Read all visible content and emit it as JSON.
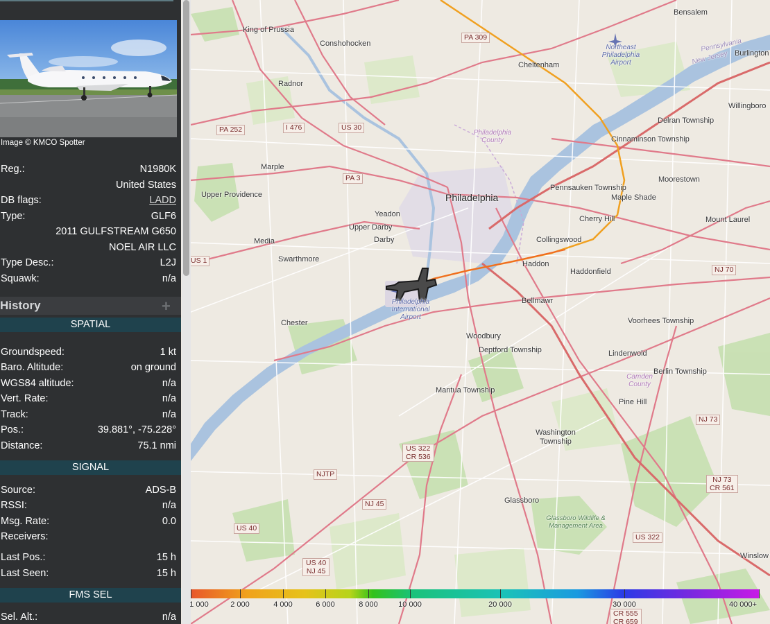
{
  "sidebar": {
    "photo_credit": "Image © KMCO Spotter",
    "details": [
      {
        "label": "Reg.:",
        "value": "N1980K"
      },
      {
        "label": "",
        "value": "United States"
      },
      {
        "label": "DB flags:",
        "value": "LADD"
      },
      {
        "label": "Type:",
        "value": "GLF6"
      },
      {
        "label": "",
        "value": "2011 GULFSTREAM G650"
      },
      {
        "label": "",
        "value": "NOEL AIR LLC"
      },
      {
        "label": "Type Desc.:",
        "value": "L2J"
      },
      {
        "label": "Squawk:",
        "value": "n/a"
      }
    ],
    "history_title": "History",
    "history_expand": "+",
    "spatial": {
      "title": "SPATIAL",
      "rows": [
        {
          "label": "Groundspeed:",
          "value": "1 kt"
        },
        {
          "label": "Baro. Altitude:",
          "value": "on ground"
        },
        {
          "label": "WGS84 altitude:",
          "value": "n/a"
        },
        {
          "label": "Vert. Rate:",
          "value": "n/a"
        },
        {
          "label": "Track:",
          "value": "n/a"
        },
        {
          "label": "Pos.:",
          "value": "39.881°, -75.228°"
        },
        {
          "label": "Distance:",
          "value": "75.1 nmi"
        }
      ]
    },
    "signal": {
      "title": "SIGNAL",
      "rows": [
        {
          "label": "Source:",
          "value": "ADS-B"
        },
        {
          "label": "RSSI:",
          "value": "n/a"
        },
        {
          "label": "Msg. Rate:",
          "value": "0.0"
        },
        {
          "label": "Receivers:",
          "value": ""
        },
        {
          "label": "Last Pos.:",
          "value": "15 h"
        },
        {
          "label": "Last Seen:",
          "value": "15 h"
        }
      ]
    },
    "fms": {
      "title": "FMS SEL",
      "rows": [
        {
          "label": "Sel. Alt.:",
          "value": "n/a"
        }
      ]
    }
  },
  "map": {
    "places": {
      "philadelphia": "Philadelphia",
      "king_of_prussia": "King of Prussia",
      "conshohocken": "Conshohocken",
      "radnor": "Radnor",
      "cheltenham": "Cheltenham",
      "bensalem": "Bensalem",
      "burlington": "Burlington",
      "willingboro": "Willingboro",
      "delran": "Delran Township",
      "cinnaminson": "Cinnaminson Township",
      "moorestown": "Moorestown",
      "maple_shade": "Maple Shade",
      "mount_laurel": "Mount Laurel",
      "pennsauken": "Pennsauken Township",
      "cherry_hill": "Cherry Hill",
      "collingswood": "Collingswood",
      "haddon": "Haddon",
      "haddonfield": "Haddonfield",
      "bellmawr": "Bellmawr",
      "voorhees": "Voorhees Township",
      "woodbury": "Woodbury",
      "deptford": "Deptford Township",
      "lindenwold": "Lindenwold",
      "berlin": "Berlin Township",
      "pine_hill": "Pine Hill",
      "mantua": "Mantua Township",
      "washington": "Washington Township",
      "glassboro": "Glassboro",
      "winslow": "Winslow",
      "marple": "Marple",
      "upper_providence": "Upper Providence",
      "yeadon": "Yeadon",
      "upper_darby": "Upper Darby",
      "darby": "Darby",
      "media": "Media",
      "swarthmore": "Swarthmore",
      "chester": "Chester",
      "philadelphia_county": "Philadelphia County",
      "camden_county": "Camden County",
      "ne_airport": "Northeast Philadelphia Airport",
      "phl_airport": "Philadelphia International Airport",
      "glassboro_wma": "Glassboro Wildlife & Management Area",
      "pennsylvania": "Pennsylvania",
      "new_jersey": "New Jersey"
    },
    "shields": {
      "pa309": "PA 309",
      "pa252": "PA 252",
      "i476": "I 476",
      "us30": "US 30",
      "pa3": "PA 3",
      "us1": "US 1",
      "nj70": "NJ 70",
      "nj73": "NJ 73",
      "us322_cr536": [
        "US 322",
        "CR 536"
      ],
      "njtp": "NJTP",
      "nj45": "NJ 45",
      "us40": "US 40",
      "us40_nj45": [
        "US 40",
        "NJ 45"
      ],
      "us322": "US 322",
      "nj73_cr561": [
        "NJ 73",
        "CR 561"
      ],
      "cr555_cr659": [
        "CR 555",
        "CR 659"
      ]
    }
  },
  "legend": {
    "labels": [
      "1 000",
      "2 000",
      "4 000",
      "6 000",
      "8 000",
      "10 000",
      "20 000",
      "30 000",
      "40 000+"
    ]
  }
}
